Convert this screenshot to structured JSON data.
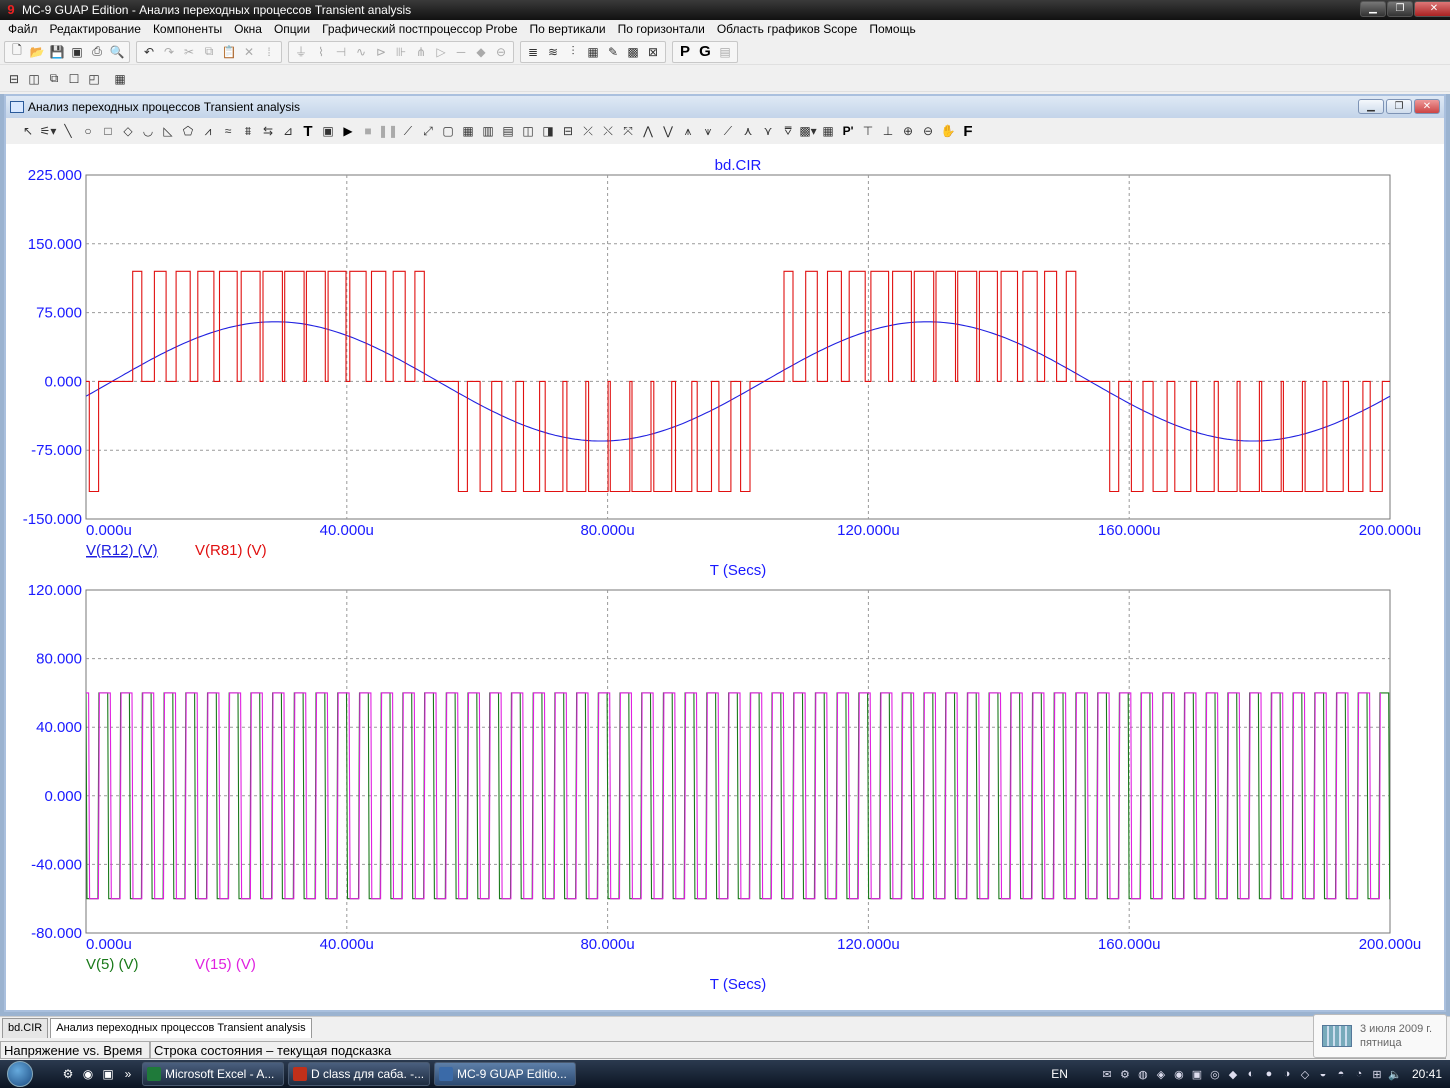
{
  "app": {
    "title": "MC-9 GUAP Edition - Анализ переходных процессов Transient analysis",
    "icon": "app-logo-icon"
  },
  "menu": [
    "Файл",
    "Редактирование",
    "Компоненты",
    "Окна",
    "Опции",
    "Графический постпроцессор Probe",
    "По вертикали",
    "По горизонтали",
    "Область графиков Scope",
    "Помощь"
  ],
  "toolbar1_icons": [
    [
      "new-file-icon",
      "open-file-icon",
      "save-icon",
      "save-as-icon",
      "print-icon",
      "print-preview-icon"
    ],
    [
      "undo-icon",
      "redo-icon",
      "cut-icon",
      "copy-icon",
      "paste-icon",
      "delete-icon",
      "select-all-icon"
    ],
    [
      "ground-icon",
      "resistor-icon",
      "capacitor-icon",
      "inductor-icon",
      "diode-icon",
      "battery-icon",
      "transistor-icon",
      "opamp-icon",
      "wire-icon",
      "node-icon",
      "source-icon"
    ],
    [
      "text-icon",
      "node-numbers-icon",
      "pin-connections-icon",
      "grid-icon",
      "attribute-icon",
      "bold-text-icon",
      "probe-icon"
    ],
    [
      "p-button-icon",
      "g-button-icon",
      "table-icon"
    ]
  ],
  "toolbar2_icons": [
    "tile-horizontal-icon",
    "tile-vertical-icon",
    "cascade-icon",
    "window-icon",
    "window-alt-icon",
    "calculator-icon"
  ],
  "child_window": {
    "title": "Анализ переходных процессов Transient analysis",
    "toolbar_icons": [
      "select-arrow-icon",
      "select-dropdown-icon",
      "line-icon",
      "ellipse-icon",
      "rectangle-icon",
      "diamond-icon",
      "arc-icon",
      "triangle-icon",
      "polygon-icon",
      "graph-icon",
      "peak-icon",
      "valley-icon",
      "high-icon",
      "low-icon",
      "text-icon",
      "properties-icon",
      "run-icon",
      "stop-icon",
      "pause-icon",
      "line-draw-icon",
      "diagonal-icon",
      "frame-icon",
      "grid-icon",
      "cursor-mode-icon",
      "scale-icon",
      "tokens-icon",
      "data-points-icon",
      "slope-icon",
      "next-point-icon",
      "previous-point-icon",
      "inflection-icon",
      "bandwidth-icon",
      "zoom-in-icon",
      "zoom-out-icon",
      "pan-icon",
      "f-icon"
    ]
  },
  "colors": {
    "axis_text": "#1a1aff",
    "blue_trace": "#2020e0",
    "red_trace": "#e01010",
    "green_trace": "#1a7a1a",
    "magenta_trace": "#e020e0",
    "grid": "#9a9a9a"
  },
  "chart_data": [
    {
      "type": "line",
      "title": "bd.CIR",
      "xlabel": "T (Secs)",
      "xlim": [
        0,
        200
      ],
      "x_unit_suffix": "u",
      "ylim": [
        -150,
        225
      ],
      "x_ticks": [
        "0.000u",
        "40.000u",
        "80.000u",
        "120.000u",
        "160.000u",
        "200.000u"
      ],
      "y_ticks": [
        "225.000",
        "150.000",
        "75.000",
        "0.000",
        "-75.000",
        "-150.000"
      ],
      "series": [
        {
          "name": "V(R12) (V)",
          "color": "#2020e0",
          "kind": "sine",
          "amplitude": 65,
          "period": 100,
          "x": [
            0,
            12.5,
            25,
            37.5,
            50,
            62.5,
            75,
            87.5,
            100,
            112.5,
            125,
            137.5,
            150,
            162.5,
            175,
            187.5,
            200
          ],
          "values": [
            0,
            46,
            65,
            46,
            0,
            -46,
            -65,
            -46,
            0,
            46,
            65,
            46,
            0,
            -46,
            -65,
            -46,
            0
          ]
        },
        {
          "name": "V(R81) (V)",
          "color": "#e01010",
          "kind": "pwm",
          "high": 120,
          "low": -120,
          "pulse_period": 3.33
        }
      ]
    },
    {
      "type": "line",
      "title": "",
      "xlabel": "T (Secs)",
      "xlim": [
        0,
        200
      ],
      "x_unit_suffix": "u",
      "ylim": [
        -80,
        120
      ],
      "x_ticks": [
        "0.000u",
        "40.000u",
        "80.000u",
        "120.000u",
        "160.000u",
        "200.000u"
      ],
      "y_ticks": [
        "120.000",
        "80.000",
        "40.000",
        "0.000",
        "-40.000",
        "-80.000"
      ],
      "series": [
        {
          "name": "V(5) (V)",
          "color": "#1a7a1a",
          "kind": "square",
          "high": 60,
          "low": -60,
          "period": 3.33
        },
        {
          "name": "V(15) (V)",
          "color": "#e020e0",
          "kind": "square",
          "high": 60,
          "low": -60,
          "period": 3.33
        }
      ]
    }
  ],
  "tabs": [
    "bd.CIR",
    "Анализ переходных процессов Transient analysis"
  ],
  "status": {
    "left": "Напряжение vs. Время",
    "right": "Строка состояния – текущая подсказка"
  },
  "date_popup": {
    "date": "3 июля 2009 г.",
    "weekday": "пятница"
  },
  "taskbar": {
    "tasks": [
      {
        "label": "Microsoft Excel - A...",
        "color": "#1f7a3a"
      },
      {
        "label": "D class для саба. -...",
        "color": "#c0301a"
      },
      {
        "label": "MC-9 GUAP Editio...",
        "color": "#3a6aa8"
      }
    ],
    "language": "EN",
    "time": "20:41"
  }
}
